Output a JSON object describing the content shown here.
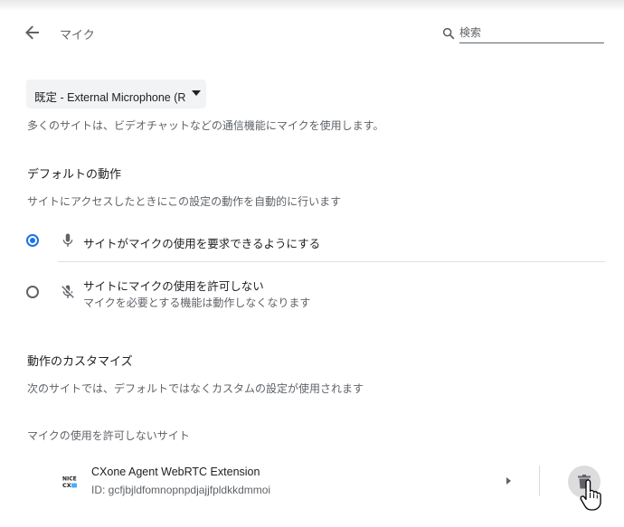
{
  "header": {
    "title": "マイク",
    "search_placeholder": "検索",
    "back_icon": "arrow-back-icon",
    "search_icon": "search-icon"
  },
  "device_selector": {
    "selected": "既定 - External Microphone (R"
  },
  "description": "多くのサイトは、ビデオチャットなどの通信機能にマイクを使用します。",
  "default_behavior": {
    "heading": "デフォルトの動作",
    "subtitle": "サイトにアクセスしたときにこの設定の動作を自動的に行います",
    "options": [
      {
        "label": "サイトがマイクの使用を要求できるようにする",
        "icon": "mic-icon",
        "checked": true
      },
      {
        "label": "サイトにマイクの使用を許可しない",
        "sublabel": "マイクを必要とする機能は動作しなくなります",
        "icon": "mic-off-icon",
        "checked": false
      }
    ]
  },
  "customized": {
    "heading": "動作のカスタマイズ",
    "subtitle": "次のサイトでは、デフォルトではなくカスタムの設定が使用されます"
  },
  "blocked_sites": {
    "heading": "マイクの使用を許可しないサイト",
    "items": [
      {
        "name": "CXone Agent WebRTC Extension",
        "id_text": "ID: gcfjbjldfomnopnpdjajjfpldkkdmmoi",
        "favicon_text": "NICE",
        "favicon_subtext": "CX"
      }
    ]
  },
  "colors": {
    "accent": "#1a73e8",
    "text_primary": "#202124",
    "text_secondary": "#5f6368"
  }
}
